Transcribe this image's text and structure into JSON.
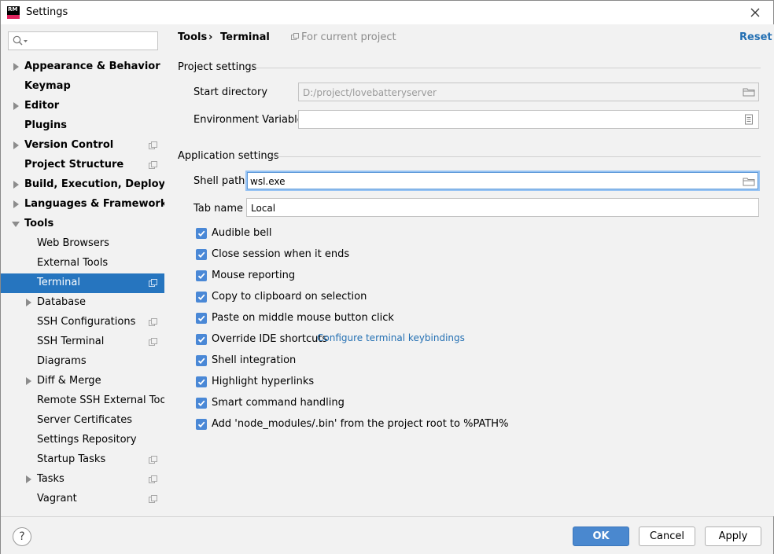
{
  "window": {
    "title": "Settings",
    "app_icon_text": "RM"
  },
  "search": {
    "placeholder": "",
    "value": ""
  },
  "sidebar": {
    "items": [
      {
        "label": "Appearance & Behavior",
        "bold": true,
        "arrow": "right",
        "indent": 0,
        "scope": false
      },
      {
        "label": "Keymap",
        "bold": true,
        "arrow": "none",
        "indent": 0,
        "scope": false
      },
      {
        "label": "Editor",
        "bold": true,
        "arrow": "right",
        "indent": 0,
        "scope": false
      },
      {
        "label": "Plugins",
        "bold": true,
        "arrow": "none",
        "indent": 0,
        "scope": false
      },
      {
        "label": "Version Control",
        "bold": true,
        "arrow": "right",
        "indent": 0,
        "scope": true
      },
      {
        "label": "Project Structure",
        "bold": true,
        "arrow": "none",
        "indent": 0,
        "scope": true
      },
      {
        "label": "Build, Execution, Deployment",
        "bold": true,
        "arrow": "right",
        "indent": 0,
        "scope": false
      },
      {
        "label": "Languages & Frameworks",
        "bold": true,
        "arrow": "right",
        "indent": 0,
        "scope": false
      },
      {
        "label": "Tools",
        "bold": true,
        "arrow": "down",
        "indent": 0,
        "scope": false
      },
      {
        "label": "Web Browsers",
        "bold": false,
        "arrow": "none",
        "indent": 1,
        "scope": false
      },
      {
        "label": "External Tools",
        "bold": false,
        "arrow": "none",
        "indent": 1,
        "scope": false
      },
      {
        "label": "Terminal",
        "bold": false,
        "arrow": "none",
        "indent": 1,
        "scope": true,
        "selected": true
      },
      {
        "label": "Database",
        "bold": false,
        "arrow": "right",
        "indent": 1,
        "scope": false
      },
      {
        "label": "SSH Configurations",
        "bold": false,
        "arrow": "none",
        "indent": 1,
        "scope": true
      },
      {
        "label": "SSH Terminal",
        "bold": false,
        "arrow": "none",
        "indent": 1,
        "scope": true
      },
      {
        "label": "Diagrams",
        "bold": false,
        "arrow": "none",
        "indent": 1,
        "scope": false
      },
      {
        "label": "Diff & Merge",
        "bold": false,
        "arrow": "right",
        "indent": 1,
        "scope": false
      },
      {
        "label": "Remote SSH External Tools",
        "bold": false,
        "arrow": "none",
        "indent": 1,
        "scope": false
      },
      {
        "label": "Server Certificates",
        "bold": false,
        "arrow": "none",
        "indent": 1,
        "scope": false
      },
      {
        "label": "Settings Repository",
        "bold": false,
        "arrow": "none",
        "indent": 1,
        "scope": false
      },
      {
        "label": "Startup Tasks",
        "bold": false,
        "arrow": "none",
        "indent": 1,
        "scope": true
      },
      {
        "label": "Tasks",
        "bold": false,
        "arrow": "right",
        "indent": 1,
        "scope": true
      },
      {
        "label": "Vagrant",
        "bold": false,
        "arrow": "none",
        "indent": 1,
        "scope": true
      }
    ]
  },
  "breadcrumb": {
    "parent": "Tools",
    "separator": "›",
    "current": "Terminal",
    "scope_note": "For current project"
  },
  "reset_label": "Reset",
  "project_settings": {
    "title": "Project settings",
    "start_directory_label": "Start directory",
    "start_directory_value": "D:/project/lovebatteryserver",
    "env_vars_label": "Environment Variables",
    "env_vars_value": ""
  },
  "application_settings": {
    "title": "Application settings",
    "shell_path_label": "Shell path",
    "shell_path_value": "wsl.exe",
    "tab_name_label": "Tab name",
    "tab_name_value": "Local"
  },
  "checkboxes": [
    {
      "label": "Audible bell",
      "checked": true
    },
    {
      "label": "Close session when it ends",
      "checked": true
    },
    {
      "label": "Mouse reporting",
      "checked": true
    },
    {
      "label": "Copy to clipboard on selection",
      "checked": true
    },
    {
      "label": "Paste on middle mouse button click",
      "checked": true
    },
    {
      "label": "Override IDE shortcuts",
      "checked": true,
      "link": "Configure terminal keybindings"
    },
    {
      "label": "Shell integration",
      "checked": true
    },
    {
      "label": "Highlight hyperlinks",
      "checked": true
    },
    {
      "label": "Smart command handling",
      "checked": true
    },
    {
      "label": "Add 'node_modules/.bin' from the project root to %PATH%",
      "checked": true
    }
  ],
  "buttons": {
    "help": "?",
    "ok": "OK",
    "cancel": "Cancel",
    "apply": "Apply"
  },
  "colors": {
    "selection": "#2675bf",
    "link": "#2470b3",
    "checkbox": "#4a88d6",
    "primary_button": "#4a88cf"
  }
}
